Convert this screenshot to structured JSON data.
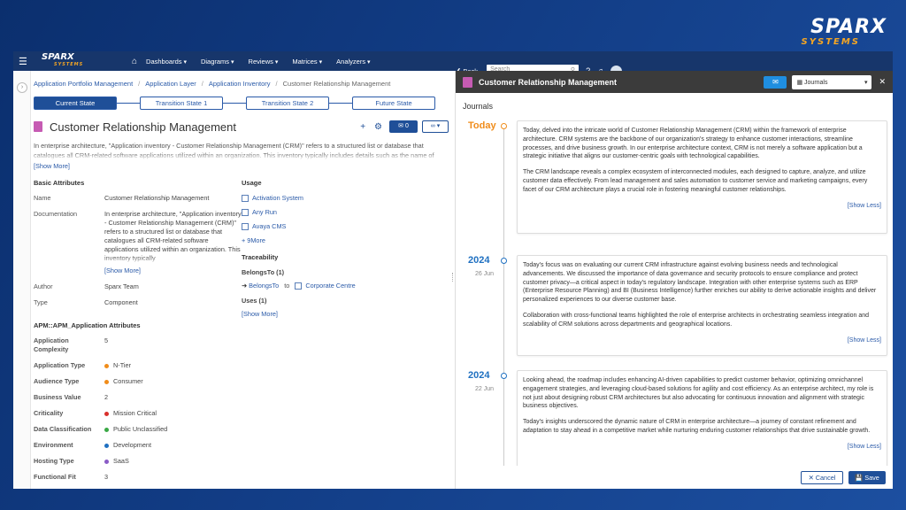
{
  "brand": {
    "name": "SPARX",
    "sub": "SYSTEMS"
  },
  "topnav": {
    "logo": "SPARX",
    "logo_sub": "SYSTEMS",
    "menu": [
      "Dashboards",
      "Diagrams",
      "Reviews",
      "Matrices",
      "Analyzers"
    ],
    "back_label": "Back",
    "search_placeholder": "Search"
  },
  "breadcrumb": [
    "Application Portfolio Management",
    "Application Layer",
    "Application Inventory",
    "Customer Relationship Management"
  ],
  "states": [
    "Current State",
    "Transition State 1",
    "Transition State 2",
    "Future State"
  ],
  "element": {
    "title": "Customer Relationship Management",
    "comment_count": "0",
    "description": "In enterprise architecture, \"Application inventory - Customer Relationship Management (CRM)\" refers to a structured list or database that catalogues all CRM-related software applications utilized within an organization. This inventory typically includes details such as the name of each",
    "show_more": "[Show More]"
  },
  "basic": {
    "heading": "Basic Attributes",
    "name_label": "Name",
    "name_value": "Customer Relationship Management",
    "doc_label": "Documentation",
    "doc_value": "In enterprise architecture, \"Application inventory - Customer Relationship Management (CRM)\" refers to a structured list or database that catalogues all CRM-related software applications utilized within an organization. This inventory typically",
    "doc_more": "[Show More]",
    "author_label": "Author",
    "author_value": "Sparx Team",
    "type_label": "Type",
    "type_value": "Component"
  },
  "usage": {
    "heading": "Usage",
    "items": [
      "Activation System",
      "Any Run",
      "Avaya CMS"
    ],
    "more": "+ 9More"
  },
  "traceability": {
    "heading": "Traceability",
    "belongs_heading": "BelongsTo (1)",
    "belongs_link": "BelongsTo",
    "to": "to",
    "target": "Corporate Centre",
    "uses_heading": "Uses (1)",
    "show_more": "[Show More]"
  },
  "apm": {
    "heading": "APM::APM_Application Attributes",
    "rows": [
      {
        "k": "Application Complexity",
        "v": "5",
        "color": ""
      },
      {
        "k": "Application Type",
        "v": "N-Tier",
        "color": "#f08c1a"
      },
      {
        "k": "Audience Type",
        "v": "Consumer",
        "color": "#f08c1a"
      },
      {
        "k": "Business Value",
        "v": "2",
        "color": ""
      },
      {
        "k": "Criticality",
        "v": "Mission Critical",
        "color": "#d9302c"
      },
      {
        "k": "Data Classification",
        "v": "Public Unclassified",
        "color": "#3aa845"
      },
      {
        "k": "Environment",
        "v": "Development",
        "color": "#1f70c1"
      },
      {
        "k": "Hosting Type",
        "v": "SaaS",
        "color": "#8a5bc6"
      },
      {
        "k": "Functional Fit",
        "v": "3",
        "color": ""
      }
    ]
  },
  "journal_panel": {
    "title": "Customer Relationship Management",
    "select_value": "Journals",
    "heading": "Journals",
    "entries": [
      {
        "date": "Today",
        "sub": "",
        "paras": [
          "Today, delved into the intricate world of Customer Relationship Management (CRM) within the framework of enterprise architecture. CRM systems are the backbone of our organization's strategy to enhance customer interactions, streamline processes, and drive business growth. In our enterprise architecture context, CRM is not merely a software application but a strategic initiative that aligns our customer-centric goals with technological capabilities.",
          "The CRM landscape reveals a complex ecosystem of interconnected modules, each designed to capture, analyze, and utilize customer data effectively. From lead management and sales automation to customer service and marketing campaigns, every facet of our CRM architecture plays a crucial role in fostering meaningful customer relationships."
        ],
        "less": "[Show Less]"
      },
      {
        "date": "2024",
        "sub": "26 Jun",
        "paras": [
          "Today's focus was on evaluating our current CRM infrastructure against evolving business needs and technological advancements. We discussed the importance of data governance and security protocols to ensure compliance and protect customer privacy—a critical aspect in today's regulatory landscape. Integration with other enterprise systems such as ERP (Enterprise Resource Planning) and BI (Business Intelligence) further enriches our ability to derive actionable insights and deliver personalized experiences to our diverse customer base.",
          "Collaboration with cross-functional teams highlighted the role of enterprise architects in orchestrating seamless integration and scalability of CRM solutions across departments and geographical locations."
        ],
        "less": "[Show Less]"
      },
      {
        "date": "2024",
        "sub": "22 Jun",
        "paras": [
          "Looking ahead, the roadmap includes enhancing AI-driven capabilities to predict customer behavior, optimizing omnichannel engagement strategies, and leveraging cloud-based solutions for agility and cost efficiency. As an enterprise architect, my role is not just about designing robust CRM architectures but also advocating for continuous innovation and alignment with strategic business objectives.",
          "Today's insights underscored the dynamic nature of CRM in enterprise architecture—a journey of constant refinement and adaptation to stay ahead in a competitive market while nurturing enduring customer relationships that drive sustainable growth."
        ],
        "less": "[Show Less]"
      }
    ],
    "cancel_label": "Cancel",
    "save_label": "Save"
  }
}
